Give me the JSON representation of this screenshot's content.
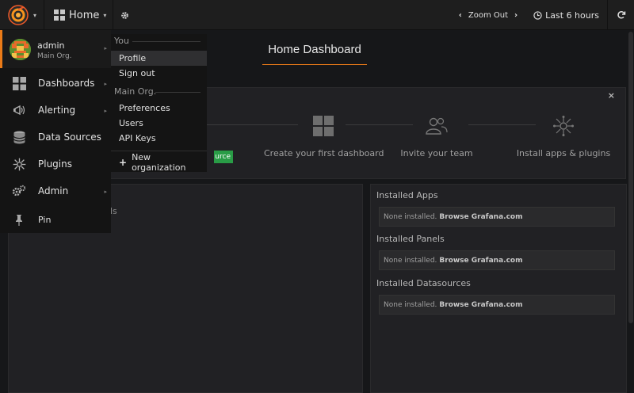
{
  "navbar": {
    "home_label": "Home",
    "zoom_out": "Zoom Out",
    "time_range": "Last 6 hours"
  },
  "dashboard": {
    "title": "Home Dashboard"
  },
  "steps": {
    "partial_button": "urce",
    "items": [
      {
        "label": "Create your first dashboard",
        "icon": "dashboard-grid-icon"
      },
      {
        "label": "Invite your team",
        "icon": "users-icon"
      },
      {
        "label": "Install apps & plugins",
        "icon": "plugins-icon"
      }
    ]
  },
  "left_panel": {
    "partial_text": "ds"
  },
  "right_panel": {
    "sections": [
      {
        "heading": "Installed Apps",
        "empty": "None installed.",
        "link": "Browse Grafana.com"
      },
      {
        "heading": "Installed Panels",
        "empty": "None installed.",
        "link": "Browse Grafana.com"
      },
      {
        "heading": "Installed Datasources",
        "empty": "None installed.",
        "link": "Browse Grafana.com"
      }
    ]
  },
  "sidemenu": {
    "user": {
      "name": "admin",
      "org": "Main Org."
    },
    "items": [
      {
        "label": "Dashboards",
        "icon": "dashboards-icon"
      },
      {
        "label": "Alerting",
        "icon": "alert-icon"
      },
      {
        "label": "Data Sources",
        "icon": "database-icon"
      },
      {
        "label": "Plugins",
        "icon": "plugins-icon"
      },
      {
        "label": "Admin",
        "icon": "admin-gear-icon"
      },
      {
        "label": "Pin",
        "icon": "pin-icon"
      }
    ]
  },
  "user_dropdown": {
    "section_you": "You",
    "profile": "Profile",
    "sign_out": "Sign out",
    "section_org": "Main Org.",
    "preferences": "Preferences",
    "users": "Users",
    "api_keys": "API Keys",
    "new_org": "New organization"
  },
  "colors": {
    "accent": "#eb7b18",
    "success": "#299c46",
    "background": "#161719"
  }
}
